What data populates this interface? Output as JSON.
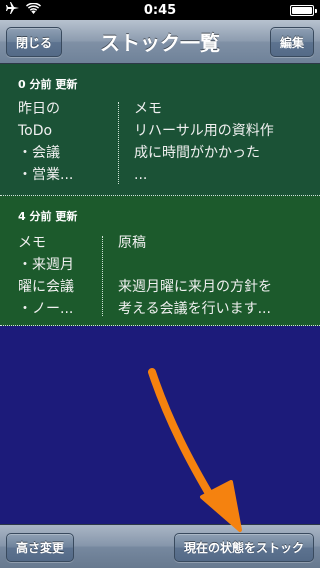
{
  "status_bar": {
    "time": "0:45",
    "airplane_icon": "airplane-icon",
    "wifi_icon": "wifi-icon",
    "battery_level": 1.0
  },
  "nav": {
    "title": "ストック一覧",
    "close_label": "閉じる",
    "edit_label": "編集"
  },
  "stocks": [
    {
      "time_label": "0 分前 更新",
      "left_lines": [
        "昨日の",
        "ToDo",
        "・会議",
        "・営業..."
      ],
      "right_lines": [
        "メモ",
        "リハーサル用の資料作",
        "成に時間がかかった",
        "..."
      ]
    },
    {
      "time_label": "4 分前 更新",
      "left_lines": [
        "メモ",
        "・来週月",
        "曜に会議",
        "・ノー..."
      ],
      "right_lines": [
        "原稿",
        "",
        "来週月曜に来月の方針を",
        "考える会議を行います..."
      ]
    }
  ],
  "toolbar": {
    "left_label": "高さ変更",
    "right_label": "現在の状態をストック"
  },
  "colors": {
    "background": "#1c1b7a",
    "stock_bg_1": "#1b5236",
    "stock_bg_2": "#1c5a2c",
    "arrow": "#f5820f"
  }
}
